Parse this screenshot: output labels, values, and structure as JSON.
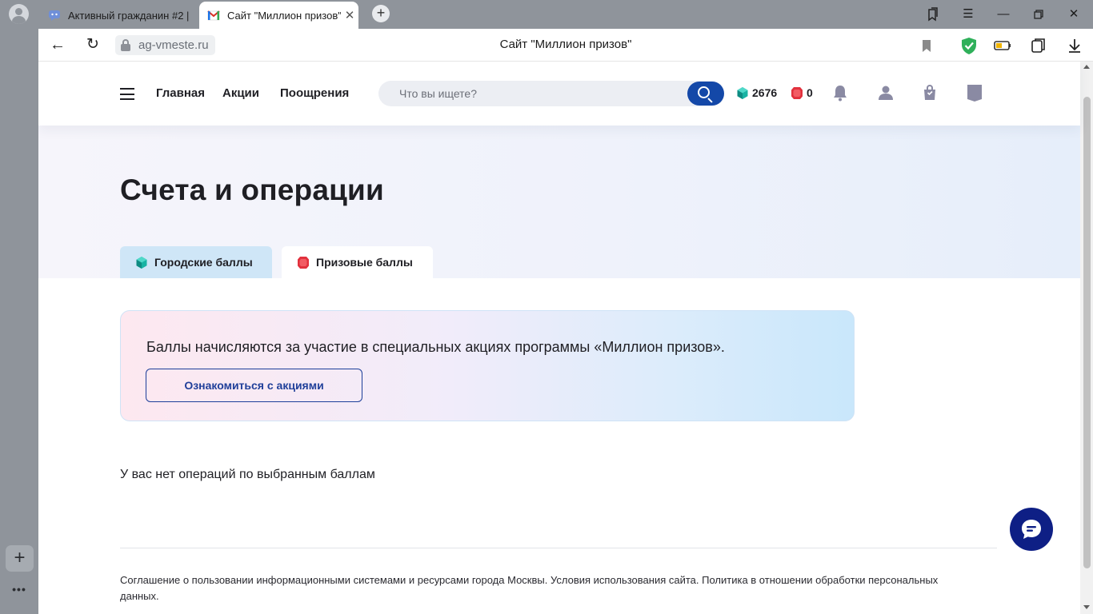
{
  "browser": {
    "tabs": [
      {
        "label": "Активный гражданин #2 |",
        "active": false
      },
      {
        "label": "Сайт \"Миллион призов\"",
        "active": true
      }
    ],
    "new_tab_symbol": "+",
    "url": "ag-vmeste.ru",
    "page_title": "Сайт \"Миллион призов\"",
    "icons": [
      "back-icon",
      "reload-icon",
      "lock-icon",
      "bookmark-icon",
      "shield-icon",
      "battery-icon",
      "collections-icon",
      "download-icon"
    ],
    "window_controls": [
      "bookmarks-tab-icon",
      "menu-icon",
      "minimize-icon",
      "restore-icon",
      "close-icon"
    ],
    "sidebar": {
      "add_symbol": "+",
      "more_symbol": "•••"
    }
  },
  "site": {
    "nav": [
      {
        "label": "Главная"
      },
      {
        "label": "Акции"
      },
      {
        "label": "Поощрения"
      }
    ],
    "search": {
      "placeholder": "Что вы ищете?"
    },
    "balances": {
      "city_points": "2676",
      "prize_points": "0"
    },
    "header_icons": [
      "bell-icon",
      "user-icon",
      "cart-bag-icon",
      "bookmark-flag-icon"
    ]
  },
  "page": {
    "title": "Счета и операции",
    "tabs": [
      {
        "label": "Городские баллы",
        "gem": "green-gem-icon",
        "active": false
      },
      {
        "label": "Призовые баллы",
        "gem": "red-gem-icon",
        "active": true
      }
    ],
    "info_card": {
      "text": "Баллы начисляются за участие в специальных акциях программы «Миллион призов».",
      "button_label": "Ознакомиться с акциями"
    },
    "empty_message": "У вас нет операций по выбранным баллам",
    "footer_text": "Соглашение о пользовании информационными системами и ресурсами города Москвы. Условия использования сайта. Политика в отношении обработки персональных данных."
  },
  "colors": {
    "brand_blue": "#1448a8",
    "chat_navy": "#0e1f85",
    "city_gem": "#17b3a3",
    "prize_gem": "#e2313d",
    "shield_green": "#2fb05a",
    "header_icon_gray": "#8a8aa3"
  }
}
